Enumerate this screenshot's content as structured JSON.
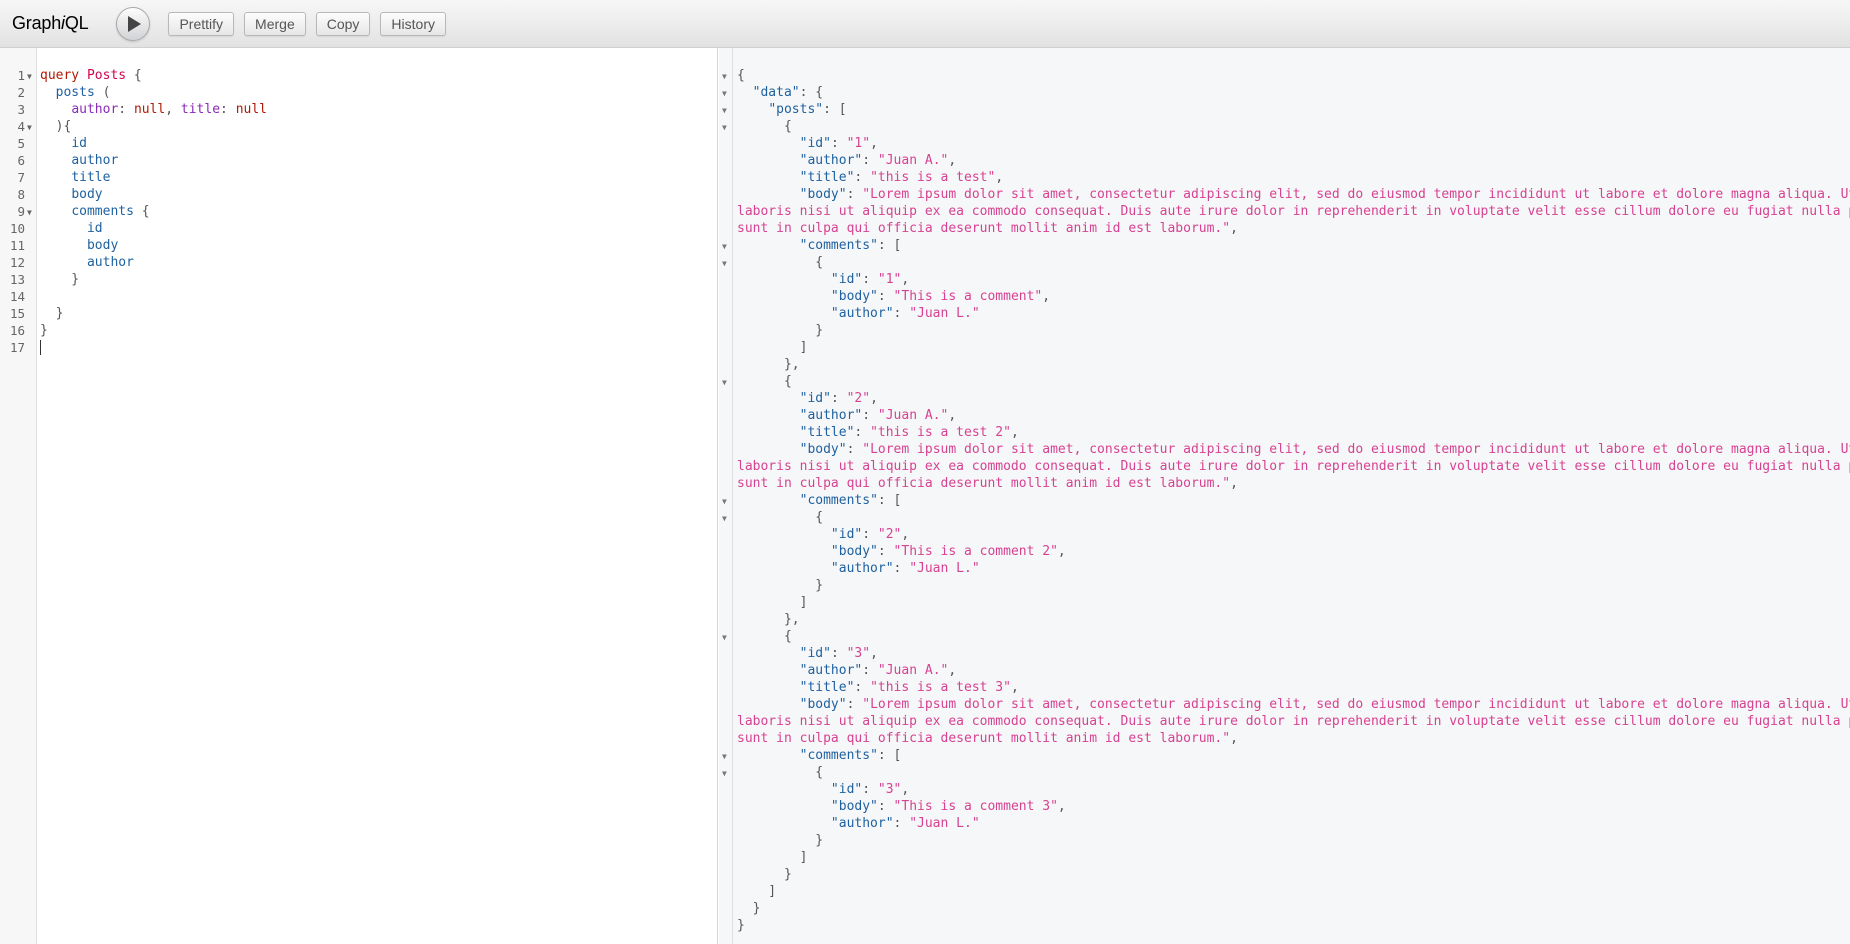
{
  "toolbar": {
    "logo_prefix": "Graph",
    "logo_italic": "i",
    "logo_suffix": "QL",
    "buttons": [
      "Prettify",
      "Merge",
      "Copy",
      "History"
    ]
  },
  "editor": {
    "lines": [
      {
        "n": "1",
        "fold": true,
        "segs": [
          [
            "kw",
            "query"
          ],
          [
            "punct",
            " "
          ],
          [
            "def",
            "Posts"
          ],
          [
            "punct",
            " {"
          ]
        ]
      },
      {
        "n": "2",
        "fold": false,
        "segs": [
          [
            "punct",
            "  "
          ],
          [
            "prop",
            "posts"
          ],
          [
            "punct",
            " ("
          ]
        ]
      },
      {
        "n": "3",
        "fold": false,
        "segs": [
          [
            "punct",
            "    "
          ],
          [
            "argname",
            "author"
          ],
          [
            "punct",
            ": "
          ],
          [
            "val",
            "null"
          ],
          [
            "punct",
            ", "
          ],
          [
            "argname",
            "title"
          ],
          [
            "punct",
            ": "
          ],
          [
            "val",
            "null"
          ]
        ]
      },
      {
        "n": "4",
        "fold": true,
        "segs": [
          [
            "punct",
            "  ){"
          ]
        ]
      },
      {
        "n": "5",
        "fold": false,
        "segs": [
          [
            "punct",
            "    "
          ],
          [
            "prop",
            "id"
          ]
        ]
      },
      {
        "n": "6",
        "fold": false,
        "segs": [
          [
            "punct",
            "    "
          ],
          [
            "prop",
            "author"
          ]
        ]
      },
      {
        "n": "7",
        "fold": false,
        "segs": [
          [
            "punct",
            "    "
          ],
          [
            "prop",
            "title"
          ]
        ]
      },
      {
        "n": "8",
        "fold": false,
        "segs": [
          [
            "punct",
            "    "
          ],
          [
            "prop",
            "body"
          ]
        ]
      },
      {
        "n": "9",
        "fold": true,
        "segs": [
          [
            "punct",
            "    "
          ],
          [
            "prop",
            "comments"
          ],
          [
            "punct",
            " {"
          ]
        ]
      },
      {
        "n": "10",
        "fold": false,
        "segs": [
          [
            "punct",
            "      "
          ],
          [
            "prop",
            "id"
          ]
        ]
      },
      {
        "n": "11",
        "fold": false,
        "segs": [
          [
            "punct",
            "      "
          ],
          [
            "prop",
            "body"
          ]
        ]
      },
      {
        "n": "12",
        "fold": false,
        "segs": [
          [
            "punct",
            "      "
          ],
          [
            "prop",
            "author"
          ]
        ]
      },
      {
        "n": "13",
        "fold": false,
        "segs": [
          [
            "punct",
            "    }"
          ]
        ]
      },
      {
        "n": "14",
        "fold": false,
        "segs": []
      },
      {
        "n": "15",
        "fold": false,
        "segs": [
          [
            "punct",
            "  }"
          ]
        ]
      },
      {
        "n": "16",
        "fold": false,
        "segs": [
          [
            "punct",
            "}"
          ]
        ]
      },
      {
        "n": "17",
        "fold": false,
        "segs": [],
        "cursor": true
      }
    ]
  },
  "result": {
    "lines": [
      {
        "fold": true,
        "segs": [
          [
            "jp",
            "{"
          ]
        ]
      },
      {
        "fold": true,
        "segs": [
          [
            "jp",
            "  "
          ],
          [
            "jkey",
            "\"data\""
          ],
          [
            "jp",
            ": {"
          ]
        ]
      },
      {
        "fold": true,
        "segs": [
          [
            "jp",
            "    "
          ],
          [
            "jkey",
            "\"posts\""
          ],
          [
            "jp",
            ": ["
          ]
        ]
      },
      {
        "fold": true,
        "segs": [
          [
            "jp",
            "      {"
          ]
        ]
      },
      {
        "fold": false,
        "segs": [
          [
            "jp",
            "        "
          ],
          [
            "jkey",
            "\"id\""
          ],
          [
            "jp",
            ": "
          ],
          [
            "jstr",
            "\"1\""
          ],
          [
            "jp",
            ","
          ]
        ]
      },
      {
        "fold": false,
        "segs": [
          [
            "jp",
            "        "
          ],
          [
            "jkey",
            "\"author\""
          ],
          [
            "jp",
            ": "
          ],
          [
            "jstr",
            "\"Juan A.\""
          ],
          [
            "jp",
            ","
          ]
        ]
      },
      {
        "fold": false,
        "segs": [
          [
            "jp",
            "        "
          ],
          [
            "jkey",
            "\"title\""
          ],
          [
            "jp",
            ": "
          ],
          [
            "jstr",
            "\"this is a test\""
          ],
          [
            "jp",
            ","
          ]
        ]
      },
      {
        "fold": false,
        "segs": [
          [
            "jp",
            "        "
          ],
          [
            "jkey",
            "\"body\""
          ],
          [
            "jp",
            ": "
          ],
          [
            "jstr",
            "\"Lorem ipsum dolor sit amet, consectetur adipiscing elit, sed do eiusmod tempor incididunt ut labore et dolore magna aliqua. Ut"
          ]
        ]
      },
      {
        "fold": false,
        "segs": [
          [
            "jstr",
            "laboris nisi ut aliquip ex ea commodo consequat. Duis aute irure dolor in reprehenderit in voluptate velit esse cillum dolore eu fugiat nulla p"
          ]
        ]
      },
      {
        "fold": false,
        "segs": [
          [
            "jstr",
            "sunt in culpa qui officia deserunt mollit anim id est laborum.\""
          ],
          [
            "jp",
            ","
          ]
        ]
      },
      {
        "fold": true,
        "segs": [
          [
            "jp",
            "        "
          ],
          [
            "jkey",
            "\"comments\""
          ],
          [
            "jp",
            ": ["
          ]
        ]
      },
      {
        "fold": true,
        "segs": [
          [
            "jp",
            "          {"
          ]
        ]
      },
      {
        "fold": false,
        "segs": [
          [
            "jp",
            "            "
          ],
          [
            "jkey",
            "\"id\""
          ],
          [
            "jp",
            ": "
          ],
          [
            "jstr",
            "\"1\""
          ],
          [
            "jp",
            ","
          ]
        ]
      },
      {
        "fold": false,
        "segs": [
          [
            "jp",
            "            "
          ],
          [
            "jkey",
            "\"body\""
          ],
          [
            "jp",
            ": "
          ],
          [
            "jstr",
            "\"This is a comment\""
          ],
          [
            "jp",
            ","
          ]
        ]
      },
      {
        "fold": false,
        "segs": [
          [
            "jp",
            "            "
          ],
          [
            "jkey",
            "\"author\""
          ],
          [
            "jp",
            ": "
          ],
          [
            "jstr",
            "\"Juan L.\""
          ]
        ]
      },
      {
        "fold": false,
        "segs": [
          [
            "jp",
            "          }"
          ]
        ]
      },
      {
        "fold": false,
        "segs": [
          [
            "jp",
            "        ]"
          ]
        ]
      },
      {
        "fold": false,
        "segs": [
          [
            "jp",
            "      },"
          ]
        ]
      },
      {
        "fold": true,
        "segs": [
          [
            "jp",
            "      {"
          ]
        ]
      },
      {
        "fold": false,
        "segs": [
          [
            "jp",
            "        "
          ],
          [
            "jkey",
            "\"id\""
          ],
          [
            "jp",
            ": "
          ],
          [
            "jstr",
            "\"2\""
          ],
          [
            "jp",
            ","
          ]
        ]
      },
      {
        "fold": false,
        "segs": [
          [
            "jp",
            "        "
          ],
          [
            "jkey",
            "\"author\""
          ],
          [
            "jp",
            ": "
          ],
          [
            "jstr",
            "\"Juan A.\""
          ],
          [
            "jp",
            ","
          ]
        ]
      },
      {
        "fold": false,
        "segs": [
          [
            "jp",
            "        "
          ],
          [
            "jkey",
            "\"title\""
          ],
          [
            "jp",
            ": "
          ],
          [
            "jstr",
            "\"this is a test 2\""
          ],
          [
            "jp",
            ","
          ]
        ]
      },
      {
        "fold": false,
        "segs": [
          [
            "jp",
            "        "
          ],
          [
            "jkey",
            "\"body\""
          ],
          [
            "jp",
            ": "
          ],
          [
            "jstr",
            "\"Lorem ipsum dolor sit amet, consectetur adipiscing elit, sed do eiusmod tempor incididunt ut labore et dolore magna aliqua. Ut"
          ]
        ]
      },
      {
        "fold": false,
        "segs": [
          [
            "jstr",
            "laboris nisi ut aliquip ex ea commodo consequat. Duis aute irure dolor in reprehenderit in voluptate velit esse cillum dolore eu fugiat nulla p"
          ]
        ]
      },
      {
        "fold": false,
        "segs": [
          [
            "jstr",
            "sunt in culpa qui officia deserunt mollit anim id est laborum.\""
          ],
          [
            "jp",
            ","
          ]
        ]
      },
      {
        "fold": true,
        "segs": [
          [
            "jp",
            "        "
          ],
          [
            "jkey",
            "\"comments\""
          ],
          [
            "jp",
            ": ["
          ]
        ]
      },
      {
        "fold": true,
        "segs": [
          [
            "jp",
            "          {"
          ]
        ]
      },
      {
        "fold": false,
        "segs": [
          [
            "jp",
            "            "
          ],
          [
            "jkey",
            "\"id\""
          ],
          [
            "jp",
            ": "
          ],
          [
            "jstr",
            "\"2\""
          ],
          [
            "jp",
            ","
          ]
        ]
      },
      {
        "fold": false,
        "segs": [
          [
            "jp",
            "            "
          ],
          [
            "jkey",
            "\"body\""
          ],
          [
            "jp",
            ": "
          ],
          [
            "jstr",
            "\"This is a comment 2\""
          ],
          [
            "jp",
            ","
          ]
        ]
      },
      {
        "fold": false,
        "segs": [
          [
            "jp",
            "            "
          ],
          [
            "jkey",
            "\"author\""
          ],
          [
            "jp",
            ": "
          ],
          [
            "jstr",
            "\"Juan L.\""
          ]
        ]
      },
      {
        "fold": false,
        "segs": [
          [
            "jp",
            "          }"
          ]
        ]
      },
      {
        "fold": false,
        "segs": [
          [
            "jp",
            "        ]"
          ]
        ]
      },
      {
        "fold": false,
        "segs": [
          [
            "jp",
            "      },"
          ]
        ]
      },
      {
        "fold": true,
        "segs": [
          [
            "jp",
            "      {"
          ]
        ]
      },
      {
        "fold": false,
        "segs": [
          [
            "jp",
            "        "
          ],
          [
            "jkey",
            "\"id\""
          ],
          [
            "jp",
            ": "
          ],
          [
            "jstr",
            "\"3\""
          ],
          [
            "jp",
            ","
          ]
        ]
      },
      {
        "fold": false,
        "segs": [
          [
            "jp",
            "        "
          ],
          [
            "jkey",
            "\"author\""
          ],
          [
            "jp",
            ": "
          ],
          [
            "jstr",
            "\"Juan A.\""
          ],
          [
            "jp",
            ","
          ]
        ]
      },
      {
        "fold": false,
        "segs": [
          [
            "jp",
            "        "
          ],
          [
            "jkey",
            "\"title\""
          ],
          [
            "jp",
            ": "
          ],
          [
            "jstr",
            "\"this is a test 3\""
          ],
          [
            "jp",
            ","
          ]
        ]
      },
      {
        "fold": false,
        "segs": [
          [
            "jp",
            "        "
          ],
          [
            "jkey",
            "\"body\""
          ],
          [
            "jp",
            ": "
          ],
          [
            "jstr",
            "\"Lorem ipsum dolor sit amet, consectetur adipiscing elit, sed do eiusmod tempor incididunt ut labore et dolore magna aliqua. Ut"
          ]
        ]
      },
      {
        "fold": false,
        "segs": [
          [
            "jstr",
            "laboris nisi ut aliquip ex ea commodo consequat. Duis aute irure dolor in reprehenderit in voluptate velit esse cillum dolore eu fugiat nulla p"
          ]
        ]
      },
      {
        "fold": false,
        "segs": [
          [
            "jstr",
            "sunt in culpa qui officia deserunt mollit anim id est laborum.\""
          ],
          [
            "jp",
            ","
          ]
        ]
      },
      {
        "fold": true,
        "segs": [
          [
            "jp",
            "        "
          ],
          [
            "jkey",
            "\"comments\""
          ],
          [
            "jp",
            ": ["
          ]
        ]
      },
      {
        "fold": true,
        "segs": [
          [
            "jp",
            "          {"
          ]
        ]
      },
      {
        "fold": false,
        "segs": [
          [
            "jp",
            "            "
          ],
          [
            "jkey",
            "\"id\""
          ],
          [
            "jp",
            ": "
          ],
          [
            "jstr",
            "\"3\""
          ],
          [
            "jp",
            ","
          ]
        ]
      },
      {
        "fold": false,
        "segs": [
          [
            "jp",
            "            "
          ],
          [
            "jkey",
            "\"body\""
          ],
          [
            "jp",
            ": "
          ],
          [
            "jstr",
            "\"This is a comment 3\""
          ],
          [
            "jp",
            ","
          ]
        ]
      },
      {
        "fold": false,
        "segs": [
          [
            "jp",
            "            "
          ],
          [
            "jkey",
            "\"author\""
          ],
          [
            "jp",
            ": "
          ],
          [
            "jstr",
            "\"Juan L.\""
          ]
        ]
      },
      {
        "fold": false,
        "segs": [
          [
            "jp",
            "          }"
          ]
        ]
      },
      {
        "fold": false,
        "segs": [
          [
            "jp",
            "        ]"
          ]
        ]
      },
      {
        "fold": false,
        "segs": [
          [
            "jp",
            "      }"
          ]
        ]
      },
      {
        "fold": false,
        "segs": [
          [
            "jp",
            "    ]"
          ]
        ]
      },
      {
        "fold": false,
        "segs": [
          [
            "jp",
            "  }"
          ]
        ]
      },
      {
        "fold": false,
        "segs": [
          [
            "jp",
            "}"
          ]
        ]
      }
    ]
  }
}
